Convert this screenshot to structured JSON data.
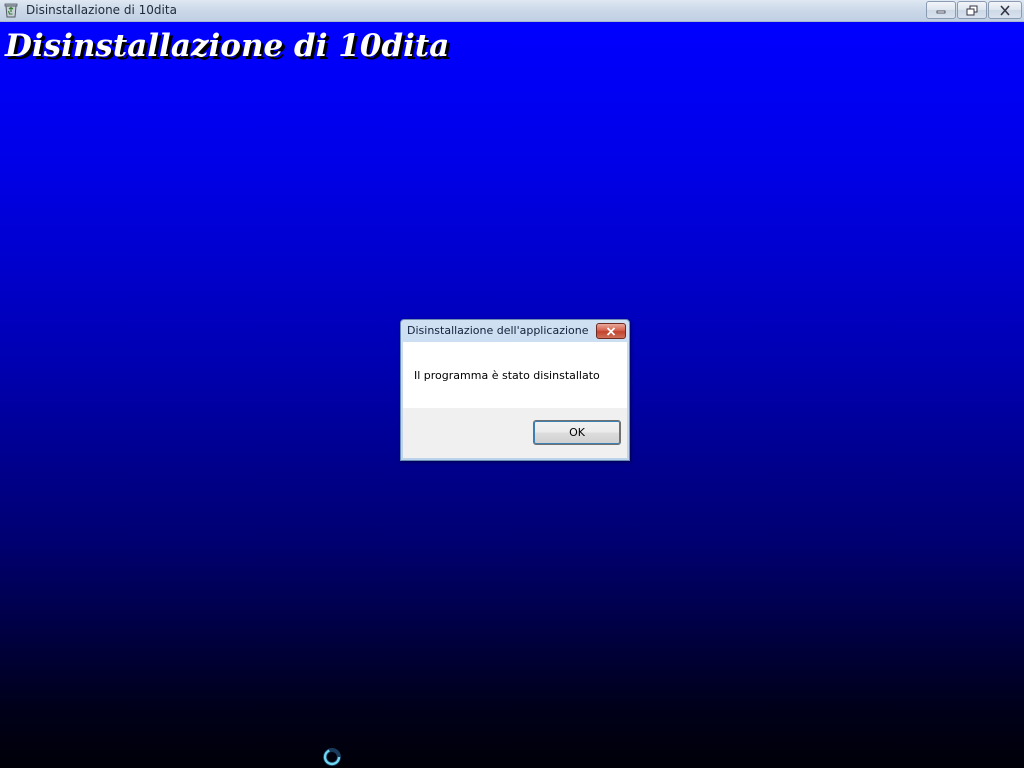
{
  "window": {
    "title": "Disinstallazione di 10dita",
    "app_icon": "recycle-bin-icon",
    "controls": {
      "minimize_icon": "minimize-icon",
      "restore_icon": "restore-icon",
      "close_icon": "close-icon"
    }
  },
  "main": {
    "heading": "Disinstallazione di 10dita",
    "background_colors": [
      "#0000ff",
      "#000008"
    ]
  },
  "dialog": {
    "title": "Disinstallazione dell'applicazione",
    "message": "Il programma è stato disinstallato",
    "ok_label": "OK",
    "close_icon": "close-icon"
  },
  "cursor": {
    "icon": "busy-cursor-icon"
  }
}
